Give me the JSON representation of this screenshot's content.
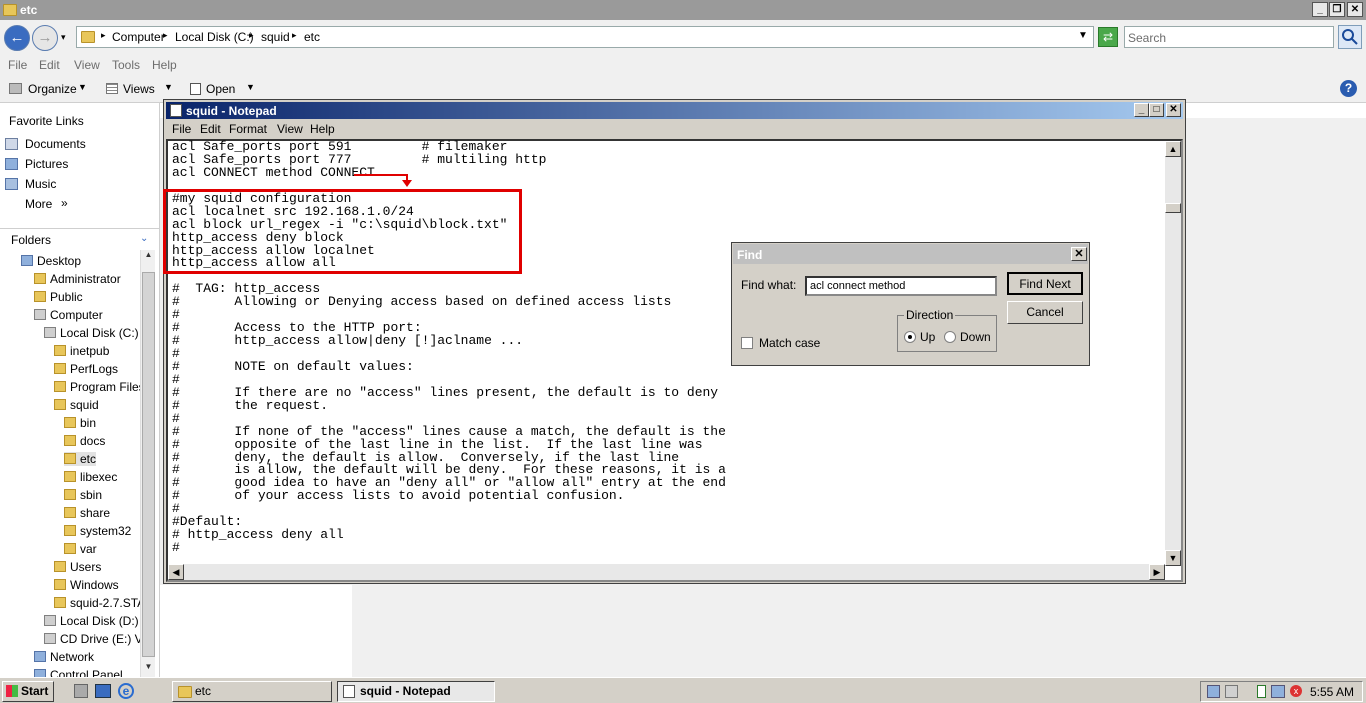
{
  "explorer": {
    "title": "etc",
    "address": [
      "Computer",
      "Local Disk (C:)",
      "squid",
      "etc"
    ],
    "search_placeholder": "Search",
    "menu": [
      "File",
      "Edit",
      "View",
      "Tools",
      "Help"
    ],
    "toolbar": {
      "organize": "Organize",
      "views": "Views",
      "open": "Open"
    },
    "favorite_links_title": "Favorite Links",
    "favorites": [
      "Documents",
      "Pictures",
      "Music",
      "More"
    ],
    "folders_title": "Folders",
    "tree": [
      "Desktop",
      "Administrator",
      "Public",
      "Computer",
      "Local Disk (C:)",
      "inetpub",
      "PerfLogs",
      "Program Files",
      "squid",
      "bin",
      "docs",
      "etc",
      "libexec",
      "sbin",
      "share",
      "system32",
      "var",
      "Users",
      "Windows",
      "squid-2.7.STA",
      "Local Disk (D:)",
      "CD Drive (E:) Vir",
      "Network",
      "Control Panel"
    ]
  },
  "notepad": {
    "title": "squid - Notepad",
    "menu": [
      "File",
      "Edit",
      "Format",
      "View",
      "Help"
    ],
    "text": "acl Safe_ports port 591         # filemaker\nacl Safe_ports port 777         # multiling http\nacl CONNECT method CONNECT\n\n#my squid configuration\nacl localnet src 192.168.1.0/24\nacl block url_regex -i \"c:\\squid\\block.txt\"\nhttp_access deny block\nhttp_access allow localnet\nhttp_access allow all\n\n#  TAG: http_access\n#\tAllowing or Denying access based on defined access lists\n#\n#\tAccess to the HTTP port:\n#\thttp_access allow|deny [!]aclname ...\n#\n#\tNOTE on default values:\n#\n#\tIf there are no \"access\" lines present, the default is to deny\n#\tthe request.\n#\n#\tIf none of the \"access\" lines cause a match, the default is the\n#\topposite of the last line in the list.  If the last line was\n#\tdeny, the default is allow.  Conversely, if the last line\n#\tis allow, the default will be deny.  For these reasons, it is a\n#\tgood idea to have an \"deny all\" or \"allow all\" entry at the end\n#\tof your access lists to avoid potential confusion.\n#\n#Default:\n# http_access deny all\n#"
  },
  "find": {
    "title": "Find",
    "find_what_label": "Find what:",
    "find_what_value": "acl connect method",
    "find_next": "Find Next",
    "cancel": "Cancel",
    "direction_label": "Direction",
    "up": "Up",
    "down": "Down",
    "match_case": "Match case"
  },
  "taskbar": {
    "start": "Start",
    "tasks": [
      "etc",
      "squid - Notepad"
    ],
    "clock": "5:55 AM"
  },
  "colors": {
    "highlight_box": "#e00000",
    "notepad_title": "#0a246a"
  }
}
